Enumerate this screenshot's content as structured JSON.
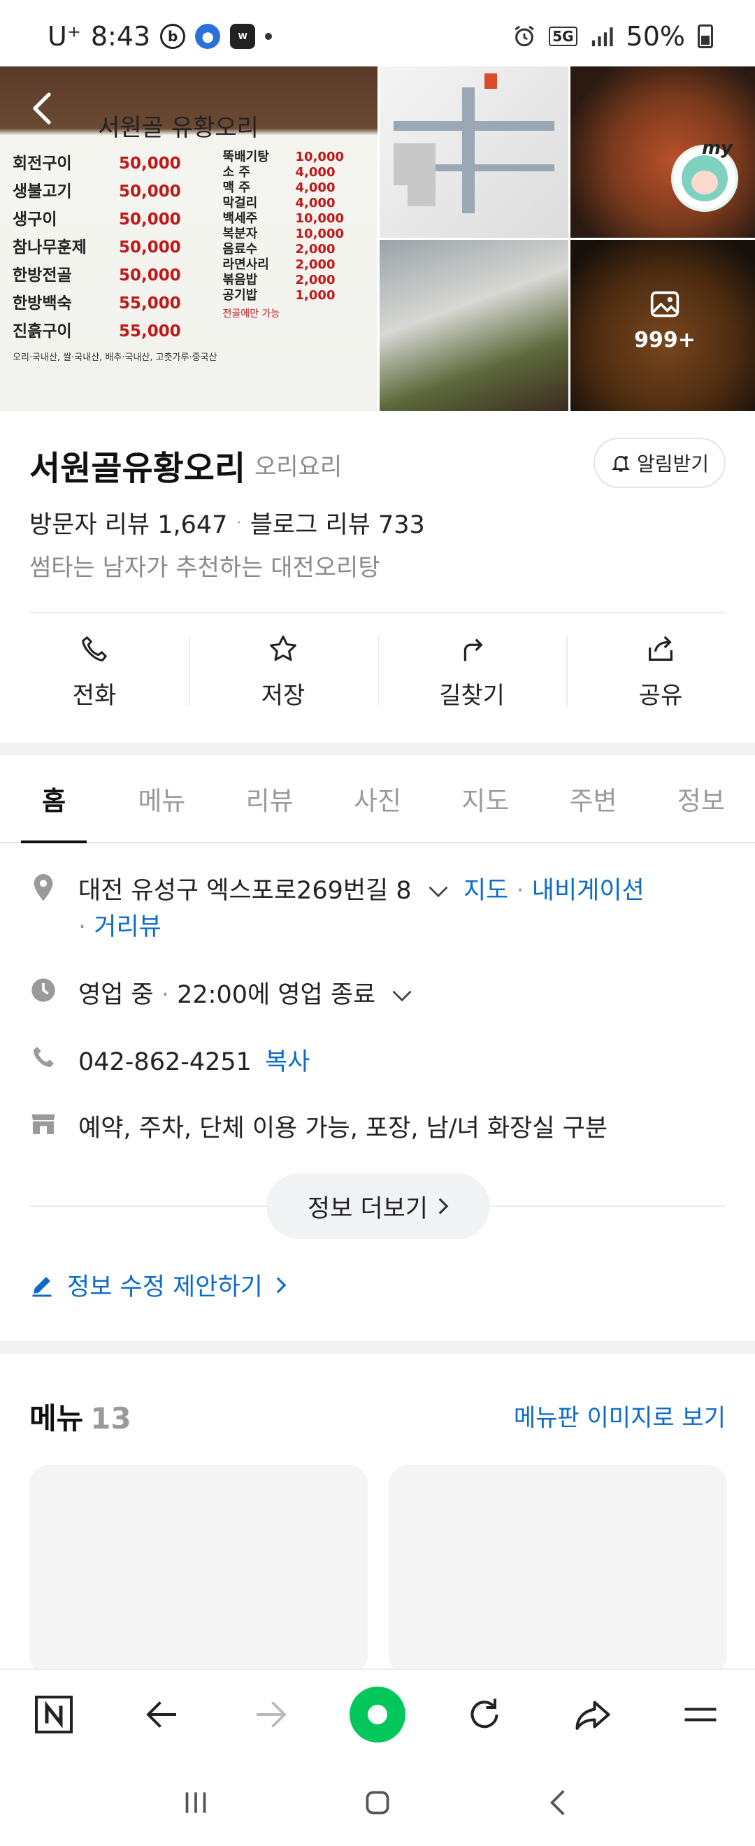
{
  "status_bar": {
    "carrier": "U⁺",
    "time": "8:43",
    "app_icons": [
      "b-icon",
      "map-pin-app-icon",
      "webtoon-icon"
    ],
    "network": "5G",
    "battery": "50%"
  },
  "gallery": {
    "photo_count": "999+",
    "menu_board": {
      "title": "서원골 유황오리",
      "left_items": [
        {
          "name": "회전구이",
          "price": "50,000"
        },
        {
          "name": "생불고기",
          "price": "50,000"
        },
        {
          "name": "생구이",
          "price": "50,000"
        },
        {
          "name": "참나무훈제",
          "price": "50,000"
        },
        {
          "name": "한방전골",
          "price": "50,000"
        },
        {
          "name": "한방백숙",
          "price": "55,000"
        },
        {
          "name": "진흙구이",
          "price": "55,000"
        }
      ],
      "right_items": [
        {
          "name": "뚝배기탕",
          "price": "10,000"
        },
        {
          "name": "소 주",
          "price": "4,000"
        },
        {
          "name": "맥 주",
          "price": "4,000"
        },
        {
          "name": "막걸리",
          "price": "4,000"
        },
        {
          "name": "백세주",
          "price": "10,000"
        },
        {
          "name": "복분자",
          "price": "10,000"
        },
        {
          "name": "음료수",
          "price": "2,000"
        },
        {
          "name": "라면사리",
          "price": "2,000"
        },
        {
          "name": "볶음밥",
          "price": "2,000"
        },
        {
          "name": "공기밥",
          "price": "1,000"
        }
      ],
      "note": "전골에만 가능",
      "origin": "오리·국내산, 쌀·국내산, 배추·국내산, 고춧가루·중국산"
    },
    "avatar_label": "my"
  },
  "place": {
    "name": "서원골유황오리",
    "category": "오리요리",
    "alarm_label": "알림받기",
    "visitor_reviews": "방문자 리뷰 1,647",
    "blog_reviews": "블로그 리뷰 733",
    "tagline": "썸타는 남자가 추천하는 대전오리탕"
  },
  "actions": [
    {
      "label": "전화",
      "icon": "phone-icon"
    },
    {
      "label": "저장",
      "icon": "star-icon"
    },
    {
      "label": "길찾기",
      "icon": "directions-icon"
    },
    {
      "label": "공유",
      "icon": "share-icon"
    }
  ],
  "tabs": [
    "홈",
    "메뉴",
    "리뷰",
    "사진",
    "지도",
    "주변",
    "정보"
  ],
  "info": {
    "address": "대전 유성구 엑스포로269번길 8",
    "map_link": "지도",
    "nav_link": "내비게이션",
    "street_view_link": "거리뷰",
    "hours_status": "영업 중",
    "hours_detail": "22:00에 영업 종료",
    "phone": "042-862-4251",
    "copy_label": "복사",
    "amenities": "예약, 주차, 단체 이용 가능, 포장, 남/녀 화장실 구분",
    "more_label": "정보 더보기",
    "suggest_label": "정보 수정 제안하기"
  },
  "menu_section": {
    "title": "메뉴",
    "count": "13",
    "view_label": "메뉴판 이미지로 보기"
  },
  "colors": {
    "accent_link": "#0b6bc7",
    "naver_green": "#03c75a",
    "menu_price_red": "#c01818"
  }
}
